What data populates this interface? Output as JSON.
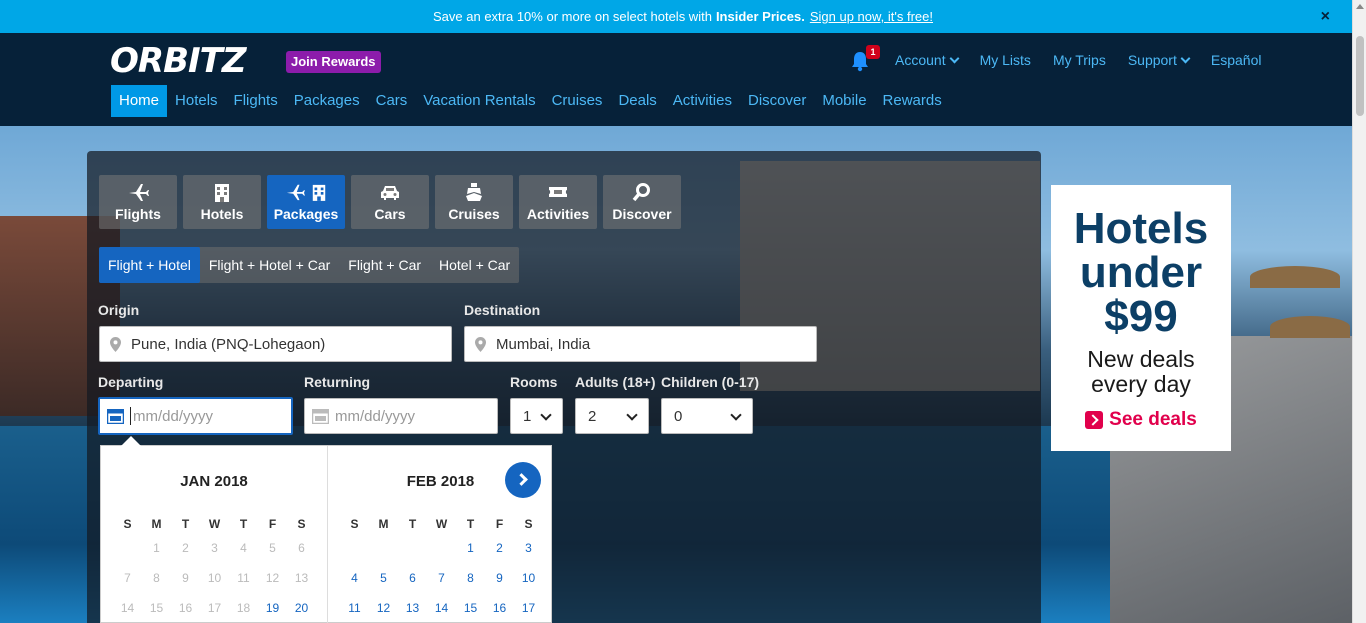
{
  "promo": {
    "text": "Save an extra 10% or more on select hotels with",
    "bold": "Insider Prices.",
    "link": "Sign up now, it's free!",
    "close": "×"
  },
  "header": {
    "logo": "ORBITZ",
    "join_rewards": "Join Rewards",
    "notification_count": "1",
    "topnav": {
      "account": "Account",
      "my_lists": "My Lists",
      "my_trips": "My Trips",
      "support": "Support",
      "espanol": "Español"
    },
    "mainnav": [
      "Home",
      "Hotels",
      "Flights",
      "Packages",
      "Cars",
      "Vacation Rentals",
      "Cruises",
      "Deals",
      "Activities",
      "Discover",
      "Mobile",
      "Rewards"
    ]
  },
  "search": {
    "product_tabs": [
      "Flights",
      "Hotels",
      "Packages",
      "Cars",
      "Cruises",
      "Activities",
      "Discover"
    ],
    "sub_tabs": [
      "Flight + Hotel",
      "Flight + Hotel + Car",
      "Flight + Car",
      "Hotel + Car"
    ],
    "origin_label": "Origin",
    "origin_value": "Pune, India (PNQ-Lohegaon)",
    "destination_label": "Destination",
    "destination_value": "Mumbai, India",
    "departing_label": "Departing",
    "departing_placeholder": "mm/dd/yyyy",
    "returning_label": "Returning",
    "returning_placeholder": "mm/dd/yyyy",
    "rooms_label": "Rooms",
    "rooms_value": "1",
    "adults_label": "Adults (18+)",
    "adults_value": "2",
    "children_label": "Children (0-17)",
    "children_value": "0"
  },
  "calendar": {
    "dow": [
      "S",
      "M",
      "T",
      "W",
      "T",
      "F",
      "S"
    ],
    "month1": {
      "title": "JAN 2018",
      "weeks": [
        [
          "",
          "1",
          "2",
          "3",
          "4",
          "5",
          "6"
        ],
        [
          "7",
          "8",
          "9",
          "10",
          "11",
          "12",
          "13"
        ],
        [
          "14",
          "15",
          "16",
          "17",
          "18",
          "19",
          "20"
        ]
      ],
      "first_available": 19
    },
    "month2": {
      "title": "FEB 2018",
      "weeks": [
        [
          "",
          "",
          "",
          "",
          "1",
          "2",
          "3"
        ],
        [
          "4",
          "5",
          "6",
          "7",
          "8",
          "9",
          "10"
        ],
        [
          "11",
          "12",
          "13",
          "14",
          "15",
          "16",
          "17"
        ]
      ],
      "first_available": 1
    }
  },
  "ad": {
    "line1": "Hotels",
    "line2": "under",
    "line3": "$99",
    "line4": "New deals",
    "line5": "every day",
    "cta": "See deals"
  },
  "colors": {
    "promo_bg": "#00a7e7",
    "header_bg": "#062139",
    "accent": "#1565c0",
    "link": "#4cb8f5",
    "rewards": "#8c1cab",
    "ad_cta": "#e1004c"
  }
}
